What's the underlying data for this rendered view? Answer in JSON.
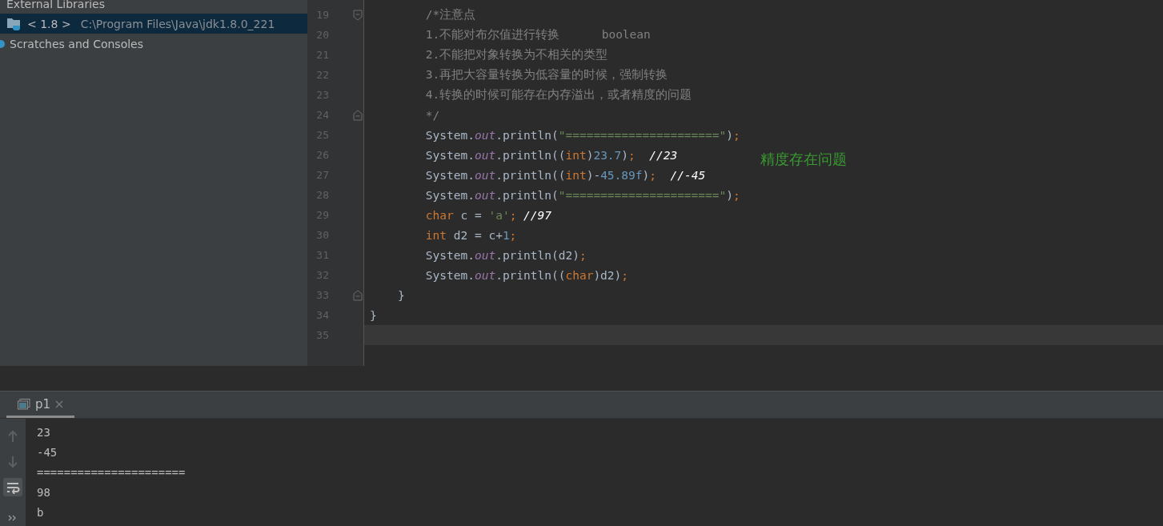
{
  "project_tree": {
    "items": [
      {
        "label": "External Libraries",
        "selected": false
      },
      {
        "label": "< 1.8 >",
        "path": "C:\\Program Files\\Java\\jdk1.8.0_221",
        "selected": true
      },
      {
        "label": "Scratches and Consoles",
        "selected": false
      }
    ]
  },
  "editor": {
    "lines": [
      {
        "number": "19",
        "kind": "fold_start",
        "current": false,
        "tokens": [
          {
            "kind": "comment",
            "text": "        /*注意点"
          }
        ]
      },
      {
        "number": "20",
        "kind": "code",
        "current": false,
        "tokens": [
          {
            "kind": "comment",
            "text": "        1.不能对布尔值进行转换      boolean"
          }
        ]
      },
      {
        "number": "21",
        "kind": "code",
        "current": false,
        "tokens": [
          {
            "kind": "comment",
            "text": "        2.不能把对象转换为不相关的类型"
          }
        ]
      },
      {
        "number": "22",
        "kind": "code",
        "current": false,
        "tokens": [
          {
            "kind": "comment",
            "text": "        3.再把大容量转换为低容量的时候，强制转换"
          }
        ]
      },
      {
        "number": "23",
        "kind": "code",
        "current": false,
        "tokens": [
          {
            "kind": "comment",
            "text": "        4.转换的时候可能存在内存溢出，或者精度的问题"
          }
        ]
      },
      {
        "number": "24",
        "kind": "fold_end",
        "current": false,
        "tokens": [
          {
            "kind": "comment",
            "text": "        */"
          }
        ]
      },
      {
        "number": "25",
        "kind": "code",
        "current": false,
        "tokens": [
          {
            "kind": "plain",
            "text": "        System."
          },
          {
            "kind": "field",
            "text": "out"
          },
          {
            "kind": "plain",
            "text": ".println("
          },
          {
            "kind": "string",
            "text": "\"======================\""
          },
          {
            "kind": "plain",
            "text": ")"
          },
          {
            "kind": "keyword",
            "text": ";"
          }
        ]
      },
      {
        "number": "26",
        "kind": "code",
        "current": false,
        "tokens": [
          {
            "kind": "plain",
            "text": "        System."
          },
          {
            "kind": "field",
            "text": "out"
          },
          {
            "kind": "plain",
            "text": ".println(("
          },
          {
            "kind": "keyword",
            "text": "int"
          },
          {
            "kind": "plain",
            "text": ")"
          },
          {
            "kind": "number",
            "text": "23.7"
          },
          {
            "kind": "plain",
            "text": ")"
          },
          {
            "kind": "keyword",
            "text": ";"
          },
          {
            "kind": "note",
            "text": "  //23"
          }
        ]
      },
      {
        "number": "27",
        "kind": "code",
        "current": false,
        "tokens": [
          {
            "kind": "plain",
            "text": "        System."
          },
          {
            "kind": "field",
            "text": "out"
          },
          {
            "kind": "plain",
            "text": ".println(("
          },
          {
            "kind": "keyword",
            "text": "int"
          },
          {
            "kind": "plain",
            "text": ")-"
          },
          {
            "kind": "number",
            "text": "45.89f"
          },
          {
            "kind": "plain",
            "text": ")"
          },
          {
            "kind": "keyword",
            "text": ";"
          },
          {
            "kind": "note",
            "text": "  //-45"
          }
        ]
      },
      {
        "number": "28",
        "kind": "code",
        "current": false,
        "tokens": [
          {
            "kind": "plain",
            "text": "        System."
          },
          {
            "kind": "field",
            "text": "out"
          },
          {
            "kind": "plain",
            "text": ".println("
          },
          {
            "kind": "string",
            "text": "\"======================\""
          },
          {
            "kind": "plain",
            "text": ")"
          },
          {
            "kind": "keyword",
            "text": ";"
          }
        ]
      },
      {
        "number": "29",
        "kind": "code",
        "current": false,
        "tokens": [
          {
            "kind": "keyword",
            "text": "        char "
          },
          {
            "kind": "plain",
            "text": "c = "
          },
          {
            "kind": "string",
            "text": "'a'"
          },
          {
            "kind": "keyword",
            "text": "; "
          },
          {
            "kind": "note",
            "text": "//97"
          }
        ]
      },
      {
        "number": "30",
        "kind": "code",
        "current": false,
        "tokens": [
          {
            "kind": "keyword",
            "text": "        int "
          },
          {
            "kind": "plain",
            "text": "d2 = c+"
          },
          {
            "kind": "number",
            "text": "1"
          },
          {
            "kind": "keyword",
            "text": ";"
          }
        ]
      },
      {
        "number": "31",
        "kind": "code",
        "current": false,
        "tokens": [
          {
            "kind": "plain",
            "text": "        System."
          },
          {
            "kind": "field",
            "text": "out"
          },
          {
            "kind": "plain",
            "text": ".println(d2)"
          },
          {
            "kind": "keyword",
            "text": ";"
          }
        ]
      },
      {
        "number": "32",
        "kind": "code",
        "current": false,
        "tokens": [
          {
            "kind": "plain",
            "text": "        System."
          },
          {
            "kind": "field",
            "text": "out"
          },
          {
            "kind": "plain",
            "text": ".println(("
          },
          {
            "kind": "keyword",
            "text": "char"
          },
          {
            "kind": "plain",
            "text": ")d2)"
          },
          {
            "kind": "keyword",
            "text": ";"
          }
        ]
      },
      {
        "number": "33",
        "kind": "fold_end",
        "current": false,
        "tokens": [
          {
            "kind": "plain",
            "text": "    }"
          }
        ]
      },
      {
        "number": "34",
        "kind": "code",
        "current": false,
        "tokens": [
          {
            "kind": "plain",
            "text": "}"
          }
        ]
      },
      {
        "number": "35",
        "kind": "code",
        "current": true
      }
    ],
    "annotation": "精度存在问题"
  },
  "run_panel": {
    "tabs": [
      {
        "label": "p1",
        "selected": true
      }
    ],
    "output": [
      "23",
      "-45",
      "======================",
      "98",
      "b"
    ]
  }
}
